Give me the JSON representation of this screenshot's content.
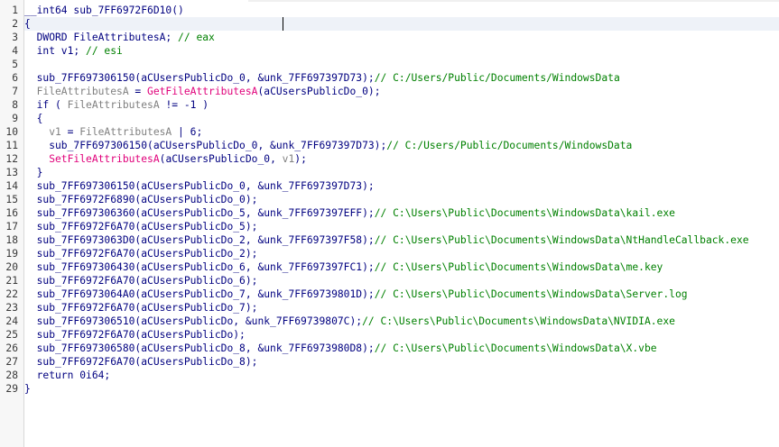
{
  "colors": {
    "plain": "#000080",
    "function": "#e0007a",
    "variable": "#808080",
    "comment": "#008000",
    "line_number": "#3a3a3a",
    "current_line": "#eef2f8"
  },
  "lines": [
    {
      "n": "1",
      "tokens": [
        [
          "plain",
          "__int64 sub_7FF6972F6D10()"
        ]
      ]
    },
    {
      "n": "2",
      "tokens": [
        [
          "plain",
          "{"
        ]
      ]
    },
    {
      "n": "3",
      "tokens": [
        [
          "plain",
          "  DWORD FileAttributesA; "
        ],
        [
          "cmt",
          "// eax"
        ]
      ]
    },
    {
      "n": "4",
      "tokens": [
        [
          "plain",
          "  int v1; "
        ],
        [
          "cmt",
          "// esi"
        ]
      ]
    },
    {
      "n": "5",
      "tokens": []
    },
    {
      "n": "6",
      "tokens": [
        [
          "plain",
          "  sub_7FF697306150(aCUsersPublicDo_0, &unk_7FF697397D73);"
        ],
        [
          "cmt",
          "// C:/Users/Public/Documents/WindowsData"
        ]
      ]
    },
    {
      "n": "7",
      "tokens": [
        [
          "var",
          "  FileAttributesA"
        ],
        [
          "plain",
          " = "
        ],
        [
          "fn",
          "GetFileAttributesA"
        ],
        [
          "plain",
          "(aCUsersPublicDo_0);"
        ]
      ]
    },
    {
      "n": "8",
      "tokens": [
        [
          "plain",
          "  if ( "
        ],
        [
          "var",
          "FileAttributesA"
        ],
        [
          "plain",
          " != -1 )"
        ]
      ]
    },
    {
      "n": "9",
      "tokens": [
        [
          "plain",
          "  {"
        ]
      ]
    },
    {
      "n": "10",
      "tokens": [
        [
          "var",
          "    v1"
        ],
        [
          "plain",
          " = "
        ],
        [
          "var",
          "FileAttributesA"
        ],
        [
          "plain",
          " | 6;"
        ]
      ]
    },
    {
      "n": "11",
      "tokens": [
        [
          "plain",
          "    sub_7FF697306150(aCUsersPublicDo_0, &unk_7FF697397D73);"
        ],
        [
          "cmt",
          "// C:/Users/Public/Documents/WindowsData"
        ]
      ]
    },
    {
      "n": "12",
      "tokens": [
        [
          "fn",
          "    SetFileAttributesA"
        ],
        [
          "plain",
          "(aCUsersPublicDo_0, "
        ],
        [
          "var",
          "v1"
        ],
        [
          "plain",
          ");"
        ]
      ]
    },
    {
      "n": "13",
      "tokens": [
        [
          "plain",
          "  }"
        ]
      ]
    },
    {
      "n": "14",
      "tokens": [
        [
          "plain",
          "  sub_7FF697306150(aCUsersPublicDo_0, &unk_7FF697397D73);"
        ]
      ]
    },
    {
      "n": "15",
      "tokens": [
        [
          "plain",
          "  sub_7FF6972F6890(aCUsersPublicDo_0);"
        ]
      ]
    },
    {
      "n": "16",
      "tokens": [
        [
          "plain",
          "  sub_7FF697306360(aCUsersPublicDo_5, &unk_7FF697397EFF);"
        ],
        [
          "cmt",
          "// C:\\Users\\Public\\Documents\\WindowsData\\kail.exe"
        ]
      ]
    },
    {
      "n": "17",
      "tokens": [
        [
          "plain",
          "  sub_7FF6972F6A70(aCUsersPublicDo_5);"
        ]
      ]
    },
    {
      "n": "18",
      "tokens": [
        [
          "plain",
          "  sub_7FF6973063D0(aCUsersPublicDo_2, &unk_7FF697397F58);"
        ],
        [
          "cmt",
          "// C:\\Users\\Public\\Documents\\WindowsData\\NtHandleCallback.exe"
        ]
      ]
    },
    {
      "n": "19",
      "tokens": [
        [
          "plain",
          "  sub_7FF6972F6A70(aCUsersPublicDo_2);"
        ]
      ]
    },
    {
      "n": "20",
      "tokens": [
        [
          "plain",
          "  sub_7FF697306430(aCUsersPublicDo_6, &unk_7FF697397FC1);"
        ],
        [
          "cmt",
          "// C:\\Users\\Public\\Documents\\WindowsData\\me.key"
        ]
      ]
    },
    {
      "n": "21",
      "tokens": [
        [
          "plain",
          "  sub_7FF6972F6A70(aCUsersPublicDo_6);"
        ]
      ]
    },
    {
      "n": "22",
      "tokens": [
        [
          "plain",
          "  sub_7FF6973064A0(aCUsersPublicDo_7, &unk_7FF69739801D);"
        ],
        [
          "cmt",
          "// C:\\Users\\Public\\Documents\\WindowsData\\Server.log"
        ]
      ]
    },
    {
      "n": "23",
      "tokens": [
        [
          "plain",
          "  sub_7FF6972F6A70(aCUsersPublicDo_7);"
        ]
      ]
    },
    {
      "n": "24",
      "tokens": [
        [
          "plain",
          "  sub_7FF697306510(aCUsersPublicDo, &unk_7FF69739807C);"
        ],
        [
          "cmt",
          "// C:\\Users\\Public\\Documents\\WindowsData\\NVIDIA.exe"
        ]
      ]
    },
    {
      "n": "25",
      "tokens": [
        [
          "plain",
          "  sub_7FF6972F6A70(aCUsersPublicDo);"
        ]
      ]
    },
    {
      "n": "26",
      "tokens": [
        [
          "plain",
          "  sub_7FF697306580(aCUsersPublicDo_8, &unk_7FF6973980D8);"
        ],
        [
          "cmt",
          "// C:\\Users\\Public\\Documents\\WindowsData\\X.vbe"
        ]
      ]
    },
    {
      "n": "27",
      "tokens": [
        [
          "plain",
          "  sub_7FF6972F6A70(aCUsersPublicDo_8);"
        ]
      ]
    },
    {
      "n": "28",
      "tokens": [
        [
          "plain",
          "  return 0i64;"
        ]
      ]
    },
    {
      "n": "29",
      "tokens": [
        [
          "plain",
          "}"
        ]
      ]
    }
  ]
}
